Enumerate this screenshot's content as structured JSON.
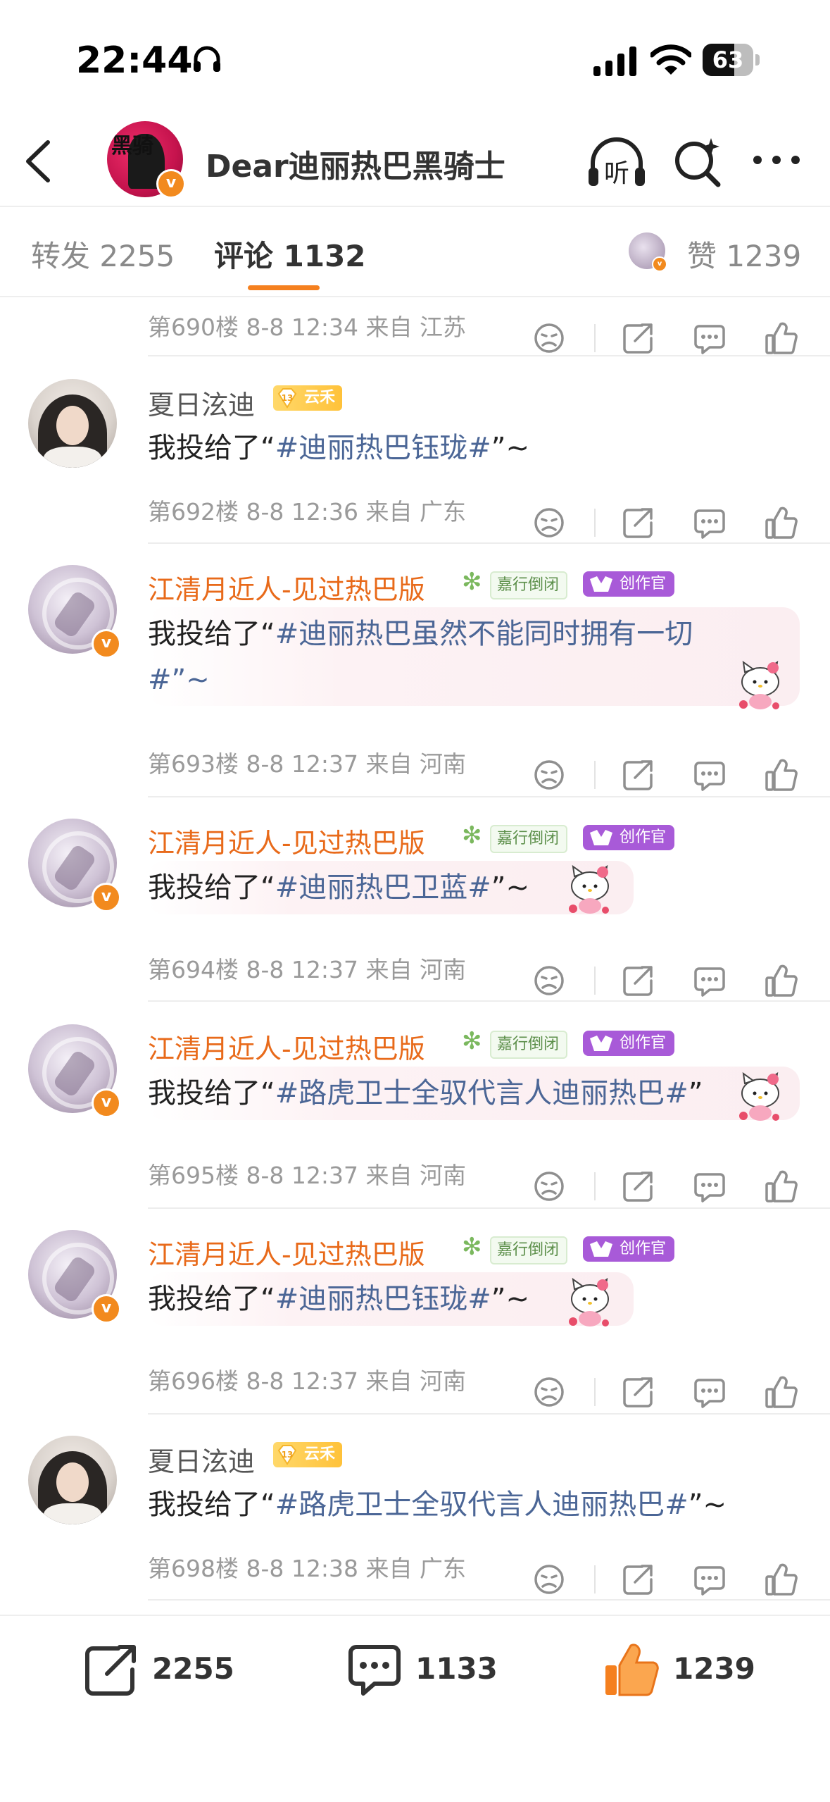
{
  "status_bar": {
    "time": "22:44",
    "battery": "63",
    "battery_level": 0.63
  },
  "header": {
    "title": "Dear迪丽热巴黑骑士",
    "avatar_text": "黑骑",
    "listen_label": "听"
  },
  "tabs": {
    "repost": "转发 2255",
    "comments": "评论 1132",
    "likes": "赞 1239"
  },
  "top_meta": {
    "floor": "第690楼",
    "time": "8-8 12:34",
    "location": "来自 江苏"
  },
  "comments": [
    {
      "user": "夏日泫迪",
      "badge_level": "13",
      "badge_text": "云禾",
      "text_pre": "我投给了“",
      "topic": "#迪丽热巴钰珑#",
      "text_post": "”~",
      "floor": "第692楼",
      "time": "8-8 12:36",
      "location": "来自 广东"
    },
    {
      "user": "江清月近人-见过热巴版",
      "badge_jx": "嘉行倒闭",
      "badge_cz": "创作官",
      "text_pre": "我投给了“",
      "topic": "#迪丽热巴虽然不能同时拥有一切",
      "text_line2": "#”~",
      "floor": "第693楼",
      "time": "8-8 12:37",
      "location": "来自 河南"
    },
    {
      "user": "江清月近人-见过热巴版",
      "badge_jx": "嘉行倒闭",
      "badge_cz": "创作官",
      "text_pre": "我投给了“",
      "topic": "#迪丽热巴卫蓝#",
      "text_post": "”~",
      "floor": "第694楼",
      "time": "8-8 12:37",
      "location": "来自 河南"
    },
    {
      "user": "江清月近人-见过热巴版",
      "badge_jx": "嘉行倒闭",
      "badge_cz": "创作官",
      "text_pre": "我投给了“",
      "topic": "#路虎卫士全驭代言人迪丽热巴#",
      "text_post": "”",
      "floor": "第695楼",
      "time": "8-8 12:37",
      "location": "来自 河南"
    },
    {
      "user": "江清月近人-见过热巴版",
      "badge_jx": "嘉行倒闭",
      "badge_cz": "创作官",
      "text_pre": "我投给了“",
      "topic": "#迪丽热巴钰珑#",
      "text_post": "”~",
      "floor": "第696楼",
      "time": "8-8 12:37",
      "location": "来自 河南"
    },
    {
      "user": "夏日泫迪",
      "badge_level": "13",
      "badge_text": "云禾",
      "text_pre": "我投给了“",
      "topic": "#路虎卫士全驭代言人迪丽热巴#",
      "text_post": "”~",
      "floor": "第698楼",
      "time": "8-8 12:38",
      "location": "来自 广东"
    }
  ],
  "bottom_bar": {
    "repost_count": "2255",
    "comment_count": "1133",
    "like_count": "1239"
  },
  "colors": {
    "accent": "#f5801f",
    "username_highlight": "#e86a1a",
    "topic": "#4b6696"
  },
  "icons": [
    "headphones-icon",
    "signal-icon",
    "wifi-icon",
    "battery-icon",
    "back-icon",
    "listen-icon",
    "search-icon",
    "more-icon",
    "dislike-icon",
    "share-icon",
    "comment-icon",
    "like-icon"
  ]
}
